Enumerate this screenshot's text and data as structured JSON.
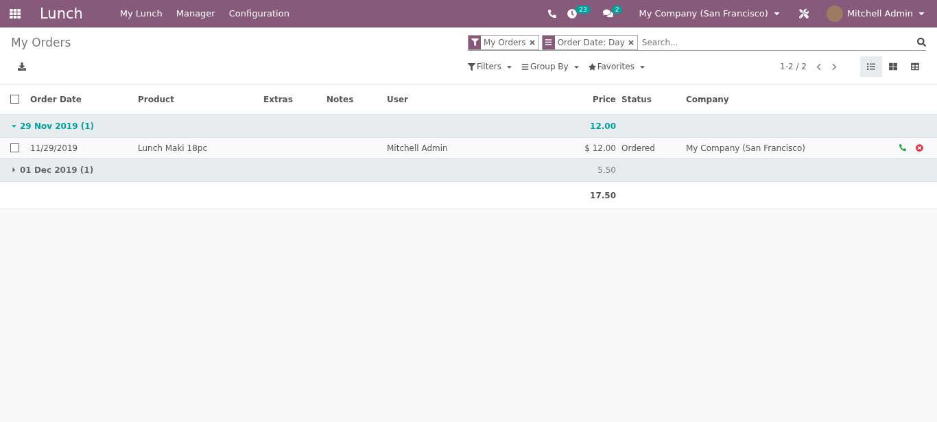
{
  "navbar": {
    "app_name": "Lunch",
    "menu": [
      "My Lunch",
      "Manager",
      "Configuration"
    ],
    "activity_badge": "23",
    "messages_badge": "2",
    "company": "My Company (San Francisco)",
    "user": "Mitchell Admin"
  },
  "control_panel": {
    "title": "My Orders",
    "facets": [
      {
        "kind": "filter",
        "label": "My Orders"
      },
      {
        "kind": "groupby",
        "label": "Order Date: Day"
      }
    ],
    "search": {
      "placeholder": "Search..."
    },
    "menus": [
      {
        "kind": "filter",
        "label": "Filters"
      },
      {
        "kind": "groupby",
        "label": "Group By"
      },
      {
        "kind": "favorites",
        "label": "Favorites"
      }
    ],
    "pager": "1-2 / 2",
    "views": [
      {
        "kind": "list",
        "selected": true
      },
      {
        "kind": "kanban",
        "selected": false
      },
      {
        "kind": "pivot",
        "selected": false
      }
    ]
  },
  "table": {
    "select_all": {
      "checked": false
    },
    "columns": [
      "Order Date",
      "Product",
      "Extras",
      "Notes",
      "User",
      "Price",
      "Status",
      "Company"
    ],
    "groups": [
      {
        "label": "29 Nov 2019 (1)",
        "expanded": true,
        "total": "12.00",
        "rows": [
          {
            "checked": false,
            "order_date": "11/29/2019",
            "product": "Lunch Maki 18pc",
            "user": "Mitchell Admin",
            "price": "$ 12.00",
            "status": "Ordered",
            "company": "My Company (San Francisco)"
          }
        ]
      },
      {
        "label": "01 Dec 2019 (1)",
        "expanded": false,
        "total": "5.50"
      }
    ],
    "grand_total": "17.50"
  }
}
